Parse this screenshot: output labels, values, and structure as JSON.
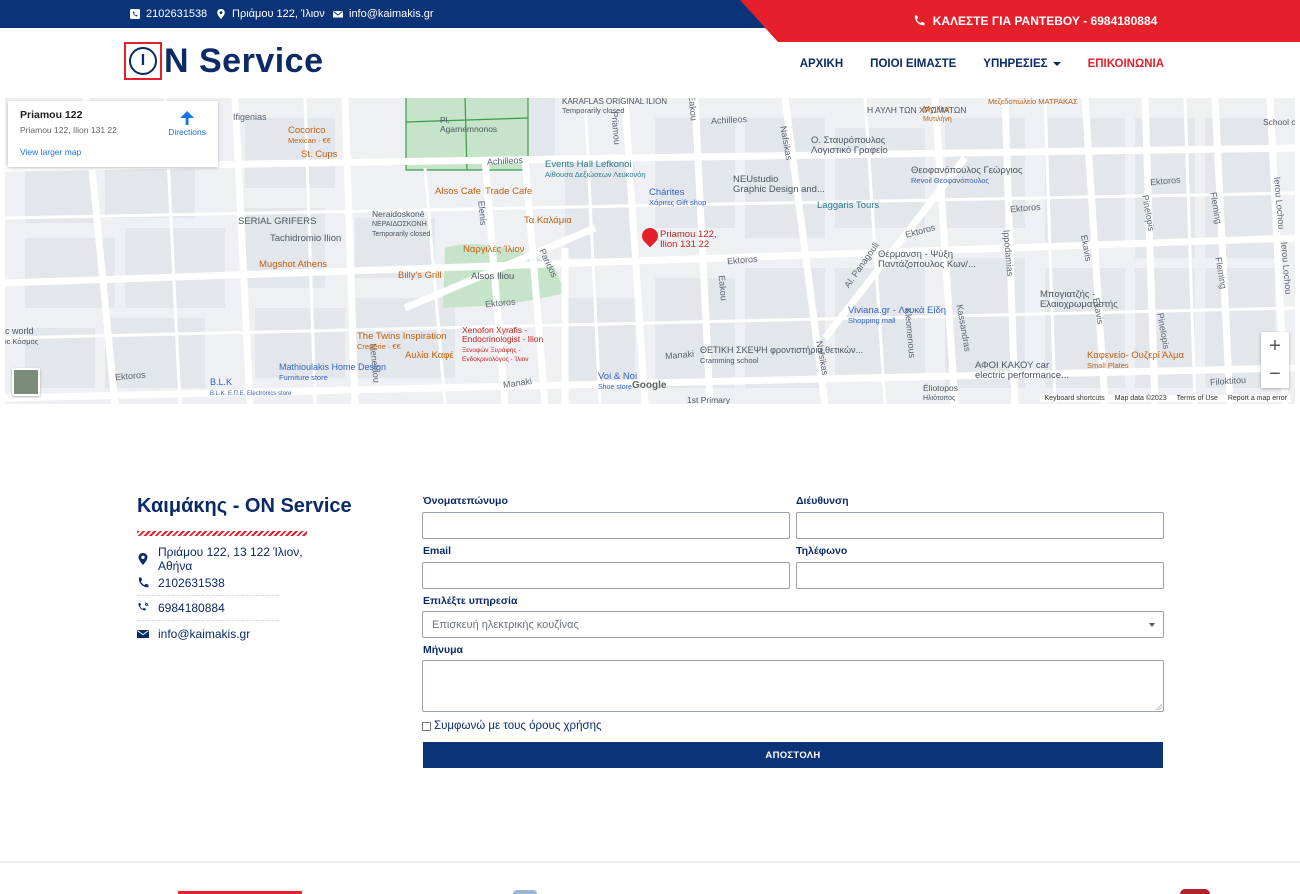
{
  "topbar": {
    "phone": "2102631538",
    "address": "Πριάμου 122, Ίλιον",
    "email": "info@kaimakis.gr",
    "cta": "ΚΑΛΕΣΤΕ ΓΙΑ ΡΑΝΤΕΒΟΥ - 6984180884"
  },
  "header": {
    "logo_letter": "I",
    "logo_text": "N Service",
    "nav": [
      "ΑΡΧΙΚΗ",
      "ΠΟΙΟΙ ΕΙΜΑΣΤΕ",
      "ΥΠΗΡΕΣΙΕΣ",
      "ΕΠΙΚΟΙΝΩΝΙΑ"
    ]
  },
  "map": {
    "card": {
      "title": "Priamou 122",
      "address": "Priamou 122, Ilion 131 22",
      "directions": "Directions",
      "larger": "View larger map"
    },
    "pin_label": [
      "Priamou 122,",
      "Ilion 131 22"
    ],
    "google": "Google",
    "footer_links": [
      "Keyboard shortcuts",
      "Map data ©2023",
      "Terms of Use",
      "Report a map error"
    ],
    "street_labels": [
      "Ifigenias",
      "Achilleos",
      "Achilleos",
      "Ektoros",
      "Ektoros",
      "Ektoros",
      "Ektoros",
      "Ektoros",
      "Manaki",
      "Manaki",
      "Menelaou",
      "Paridos",
      "Elenis",
      "Priamou",
      "Eakou",
      "Eakou",
      "Nafsikas",
      "Nafsikas",
      "Al. Panagouli",
      "Ippodamias",
      "Kassandras",
      "Kleomenous",
      "Ekavis",
      "Ekavis",
      "Pinelopis",
      "Pinelopis",
      "Fleming",
      "Fleming",
      "Ierou Lochou",
      "Ierou Lochou",
      "Filoktitou",
      "Ektoros"
    ],
    "pois": [
      {
        "name": "Cocorico",
        "sub": "Mexican · €€",
        "color": "orange"
      },
      {
        "name": "St. Cups",
        "sub": "",
        "color": "orange"
      },
      {
        "name": "SERIAL GRIFERS",
        "sub": "",
        "color": "gray"
      },
      {
        "name": "Tachidromio Ilion",
        "sub": "",
        "color": "gray"
      },
      {
        "name": "Mugshot Athens",
        "sub": "",
        "color": "orange"
      },
      {
        "name": "Pl. Agamemnonos",
        "sub": "",
        "color": "gray"
      },
      {
        "name": "KARAFLAS ORIGINAL ILION",
        "sub": "Temporarily closed",
        "color": "gray"
      },
      {
        "name": "Events Hall Lefkonoi",
        "sub": "Αίθουσα Δεξιώσεων Λευκονόη",
        "color": "teal"
      },
      {
        "name": "Neraidoskonē",
        "sub": "ΝΕΡΑΙΔΟΣΚΟΝΗ Temporarily closed",
        "color": "gray"
      },
      {
        "name": "Alsos Cafe",
        "sub": "",
        "color": "orange"
      },
      {
        "name": "Trade Cafe",
        "sub": "",
        "color": "orange"
      },
      {
        "name": "Τα Καλάμια",
        "sub": "",
        "color": "orange"
      },
      {
        "name": "Ναργιλές Ίλιον",
        "sub": "",
        "color": "orange"
      },
      {
        "name": "Billy's Grill",
        "sub": "",
        "color": "orange"
      },
      {
        "name": "Alsos Iliou",
        "sub": "",
        "color": "gray"
      },
      {
        "name": "The Twins Inspiration",
        "sub": "Creperie · €€",
        "color": "orange"
      },
      {
        "name": "Αυλία Καφέ",
        "sub": "",
        "color": "orange"
      },
      {
        "name": "Xenofon Xyrafis - Endocrinologist - Ilion",
        "sub": "Ξενοφών Ξυράφης - Ενδοκρινολόγος - Ίλιον",
        "color": "orange"
      },
      {
        "name": "Chárites",
        "sub": "Χάριτες Gift shop",
        "color": "blue"
      },
      {
        "name": "NEUstudio",
        "sub": "Graphic Design and...",
        "color": "gray"
      },
      {
        "name": "Ο. Σταυρόπουλος",
        "sub": "Λογιστικό Γραφείο",
        "color": "gray"
      },
      {
        "name": "Η ΑΥΛΗ ΤΩΝ ΧΡΩΜΑΤΩΝ",
        "sub": "",
        "color": "gray"
      },
      {
        "name": "Mytilini",
        "sub": "Μυτιλήνη",
        "color": "orange"
      },
      {
        "name": "Μεζεδοπωλείο ΜΑΤΡΑΚΑΣ",
        "sub": "",
        "color": "orange"
      },
      {
        "name": "Θεοφανόπουλος Γεώργιος",
        "sub": "Revoil Θεοφανόπουλος",
        "color": "gray"
      },
      {
        "name": "Laggaris Tours",
        "sub": "",
        "color": "teal"
      },
      {
        "name": "Θέρμανση - Ψύξη Παντάζοπουλος Κων/...",
        "sub": "",
        "color": "gray"
      },
      {
        "name": "Viviana.gr - Λευκά Είδη",
        "sub": "Shopping mall",
        "color": "blue"
      },
      {
        "name": "ΘΕΤΙΚΗ ΣΚΕΨΗ φροντιστήρια θετικών...",
        "sub": "Cramming school",
        "color": "gray"
      },
      {
        "name": "Voi & Noi",
        "sub": "Shoe store",
        "color": "blue"
      },
      {
        "name": "Μπογιατζής - Ελαιοχρωματιστής",
        "sub": "",
        "color": "gray"
      },
      {
        "name": "ΑΦΟΙ ΚΑΚΟΥ car electric performance...",
        "sub": "",
        "color": "gray"
      },
      {
        "name": "Καφενείο- Ουζερί Άλμα",
        "sub": "Small Plates",
        "color": "orange"
      },
      {
        "name": "Éliotopos",
        "sub": "Ηλιότοπος",
        "color": "gray"
      },
      {
        "name": "Mathioulakis Home Design",
        "sub": "Furniture store",
        "color": "blue"
      },
      {
        "name": "B.L.K",
        "sub": "B.L.K. Ε.Π.Ε. Electronics store",
        "color": "blue"
      },
      {
        "name": "c world",
        "sub": "ic Κόσμος",
        "color": "gray"
      },
      {
        "name": "1st Primary",
        "sub": "",
        "color": "gray"
      },
      {
        "name": "School of",
        "sub": "",
        "color": "gray"
      }
    ]
  },
  "contact": {
    "title": "Καιμάκης - ON Service",
    "address": "Πριάμου 122, 13 122 Ίλιον, Αθήνα",
    "phone": "2102631538",
    "mobile": "6984180884",
    "email": "info@kaimakis.gr"
  },
  "form": {
    "name_label": "Όνοματεπώνυμο",
    "address_label": "Διέυθυνση",
    "email_label": "Email",
    "phone_label": "Τηλέφωνο",
    "service_label": "Επιλέξτε υπηρεσία",
    "service_value": "Επισκευή ηλεκτρικής κουζίνας",
    "message_label": "Μήνυμα",
    "agree": "Συμφωνώ με τους όρους χρήσης",
    "submit": "ΑΠΟΣΤΟΛΗ"
  },
  "colors": {
    "navy": "#0b3378",
    "red": "#e5202a"
  }
}
